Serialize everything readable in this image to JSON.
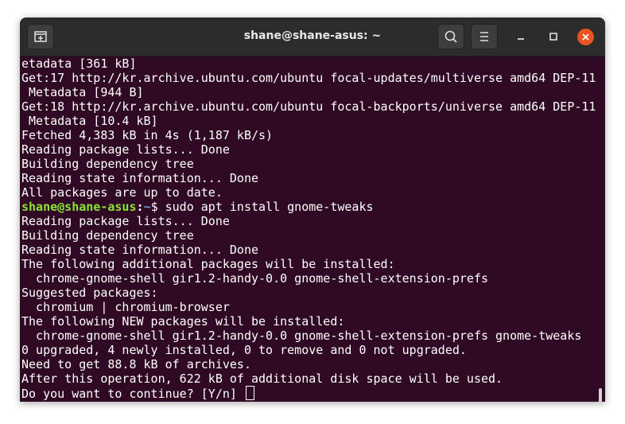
{
  "window": {
    "title": "shane@shane-asus: ~"
  },
  "colors": {
    "terminal_bg": "#300a24",
    "titlebar_bg": "#2c2c2c",
    "prompt_user": "#8ae234",
    "prompt_path": "#729fcf",
    "close_button": "#e95420"
  },
  "icons": {
    "new_tab": "new-tab-icon",
    "search": "search-icon",
    "menu": "hamburger-menu-icon",
    "minimize": "minimize-icon",
    "maximize": "maximize-icon",
    "close": "close-icon"
  },
  "terminal": {
    "lines": [
      "etadata [361 kB]",
      "Get:17 http://kr.archive.ubuntu.com/ubuntu focal-updates/multiverse amd64 DEP-11",
      " Metadata [944 B]",
      "Get:18 http://kr.archive.ubuntu.com/ubuntu focal-backports/universe amd64 DEP-11",
      " Metadata [10.4 kB]",
      "Fetched 4,383 kB in 4s (1,187 kB/s)",
      "Reading package lists... Done",
      "Building dependency tree",
      "Reading state information... Done",
      "All packages are up to date."
    ],
    "prompt": {
      "user_host": "shane@shane-asus",
      "sep": ":",
      "path": "~",
      "symbol": "$ ",
      "command": "sudo apt install gnome-tweaks"
    },
    "lines_after": [
      "Reading package lists... Done",
      "Building dependency tree",
      "Reading state information... Done",
      "The following additional packages will be installed:",
      "  chrome-gnome-shell gir1.2-handy-0.0 gnome-shell-extension-prefs",
      "Suggested packages:",
      "  chromium | chromium-browser",
      "The following NEW packages will be installed:",
      "  chrome-gnome-shell gir1.2-handy-0.0 gnome-shell-extension-prefs gnome-tweaks",
      "0 upgraded, 4 newly installed, 0 to remove and 0 not upgraded.",
      "Need to get 88.8 kB of archives.",
      "After this operation, 622 kB of additional disk space will be used."
    ],
    "final_prompt": "Do you want to continue? [Y/n] "
  }
}
